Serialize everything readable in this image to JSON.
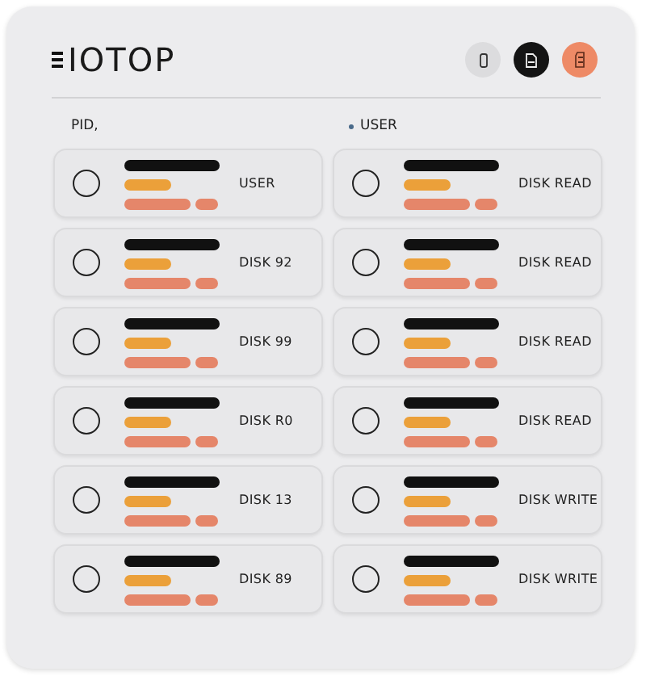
{
  "title": "IOTOP",
  "columns": [
    "PID,",
    "USER"
  ],
  "rows": [
    {
      "label": "USER",
      "selected": false
    },
    {
      "label": "DISK READ",
      "selected": false
    },
    {
      "label": "DISK 92",
      "selected": false
    },
    {
      "label": "DISK READ",
      "selected": false
    },
    {
      "label": "DISK 99",
      "selected": false
    },
    {
      "label": "DISK READ",
      "selected": false
    },
    {
      "label": "DISK R0",
      "selected": false
    },
    {
      "label": "DISK READ",
      "selected": false
    },
    {
      "label": "DISK 13",
      "selected": false
    },
    {
      "label": "DISK WRITE",
      "selected": false
    },
    {
      "label": "DISK 89",
      "selected": false
    },
    {
      "label": "DISK WRITE",
      "selected": false
    }
  ]
}
